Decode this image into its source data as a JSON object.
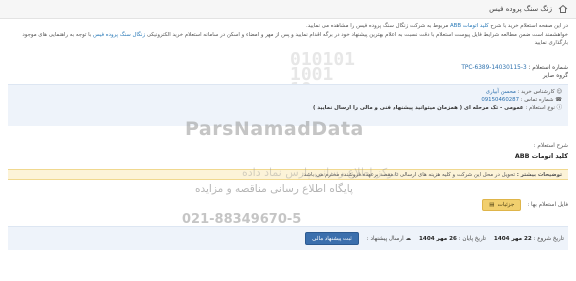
{
  "header": {
    "title": "زنگ سنگ پروده فیس"
  },
  "intro": {
    "line1_start": "در این صفحه استعلام خرید با شرح",
    "line1_item": "کلید اتومات ABB",
    "line1_end": "مربوط به شرکت زنگال سنگ پروده فیس را مشاهده می نمایید.",
    "line2_start": "خواهشمند است ضمن مطالعه شرایط فایل پیوست استعلام با دقت نسبت به اعلام بهترین پیشنهاد خود در برگه اقدام نمایید و پس از مهر و امضاء و اسکن در سامانه استعلام خرید الکترونیکی",
    "line2_company": "زنگال سنگ پروده فیس",
    "line2_end": "بارگذاری نمایید",
    "line3": "با توجه به راهنمایی های موجود"
  },
  "inquiry": {
    "number_label": "شماره استعلام :",
    "number": "TPC-6389-14030115-3",
    "buyer_company": "گروه صایر",
    "buyer_label": "کارشناس خرید :",
    "buyer_name": "محسن آبیاری",
    "phone_label": "شماره تماس :",
    "phone": "09150460287",
    "type_label": "نوع استعلام :",
    "type_value": "عمومی - تک مرحله ای ( همزمان میتوانید پیشنهاد فنی و مالی را ارسال نمایید )"
  },
  "description": {
    "label": "شرح استعلام :",
    "item": "کلید اتومات ABB"
  },
  "notice": {
    "label": "توضیحات بیشتر :",
    "text": "تحویل در محل این شرکت و کلیه هزینه های ارسالی تا مقصد برعهده فروشنده محترم می باشد."
  },
  "files": {
    "label": "فایل استعلام بها :",
    "details_button": "جزئیات"
  },
  "footer": {
    "start_label": "تاریخ شروع :",
    "start_date": "22 مهر 1404",
    "end_label": "تاریخ پایان :",
    "end_date": "26 مهر 1404",
    "send_label": "ارسال پیشنهاد :",
    "submit_button": "ثبت پیشنهاد مالی"
  },
  "watermark": {
    "digits": "010101\n1001\n10",
    "brand": "ParsNamadData",
    "line1": "مرکز اطلاع رسانی پارس نماد داده",
    "line2": "پایگاه اطلاع رسانی مناقصه و مزایده",
    "phone": "021-88349670-5"
  },
  "colors": {
    "accent": "#3b6fad",
    "link": "#2a7ab8",
    "notice_bg": "#fcf3d8",
    "button_yellow": "#f1cf6e",
    "panel_blue": "#eef3fa"
  }
}
